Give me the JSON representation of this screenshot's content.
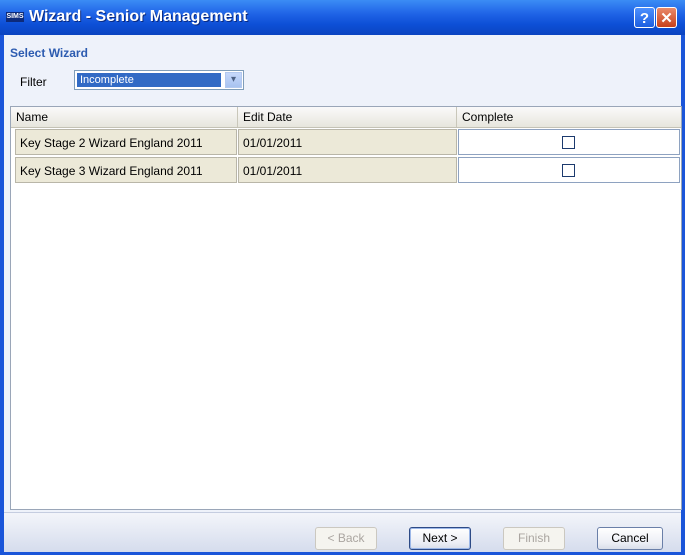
{
  "window": {
    "app_icon": "SIMS",
    "title": "Wizard - Senior Management",
    "help_label": "?",
    "close_label": "✕"
  },
  "section": {
    "title": "Select Wizard"
  },
  "filter": {
    "label": "Filter",
    "selected_value": "Incomplete"
  },
  "grid": {
    "columns": [
      "Name",
      "Edit Date",
      "Complete"
    ],
    "rows": [
      {
        "name": "Key Stage 2 Wizard England 2011",
        "edit_date": "01/01/2011",
        "complete": false
      },
      {
        "name": "Key Stage 3 Wizard England 2011",
        "edit_date": "01/01/2011",
        "complete": false
      }
    ]
  },
  "buttons": {
    "back": "< Back",
    "next": "Next >",
    "finish": "Finish",
    "cancel": "Cancel"
  },
  "colors": {
    "titlebar": "#1f63e6",
    "accent": "#2c5bb0",
    "selection": "#316ac5"
  }
}
